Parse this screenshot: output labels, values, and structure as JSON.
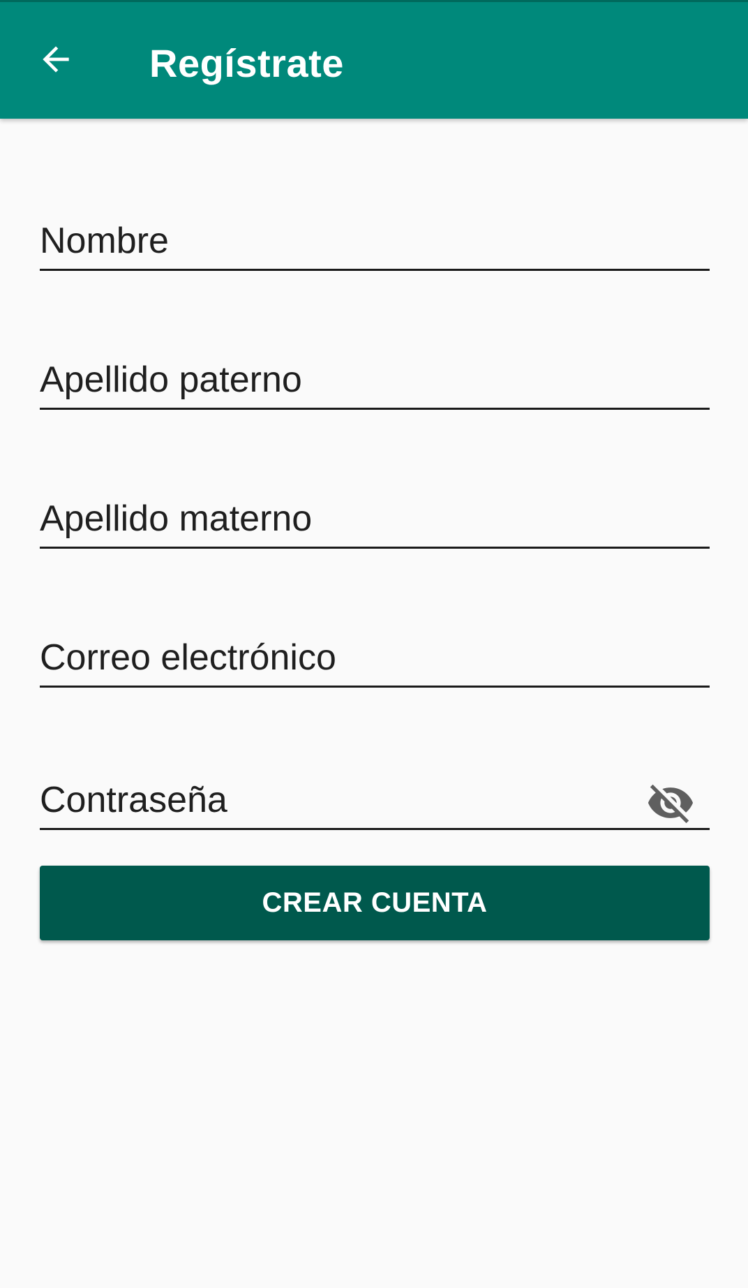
{
  "appbar": {
    "title": "Regístrate",
    "back_icon": "arrow-back-icon",
    "background_color": "#00897b"
  },
  "form": {
    "fields": [
      {
        "placeholder": "Nombre",
        "value": ""
      },
      {
        "placeholder": "Apellido paterno",
        "value": ""
      },
      {
        "placeholder": "Apellido materno",
        "value": ""
      },
      {
        "placeholder": "Correo electrónico",
        "value": ""
      },
      {
        "placeholder": "Contraseña",
        "value": "",
        "toggle_icon": "visibility-off-icon"
      }
    ],
    "submit_label": "CREAR CUENTA",
    "submit_color": "#00594d"
  }
}
